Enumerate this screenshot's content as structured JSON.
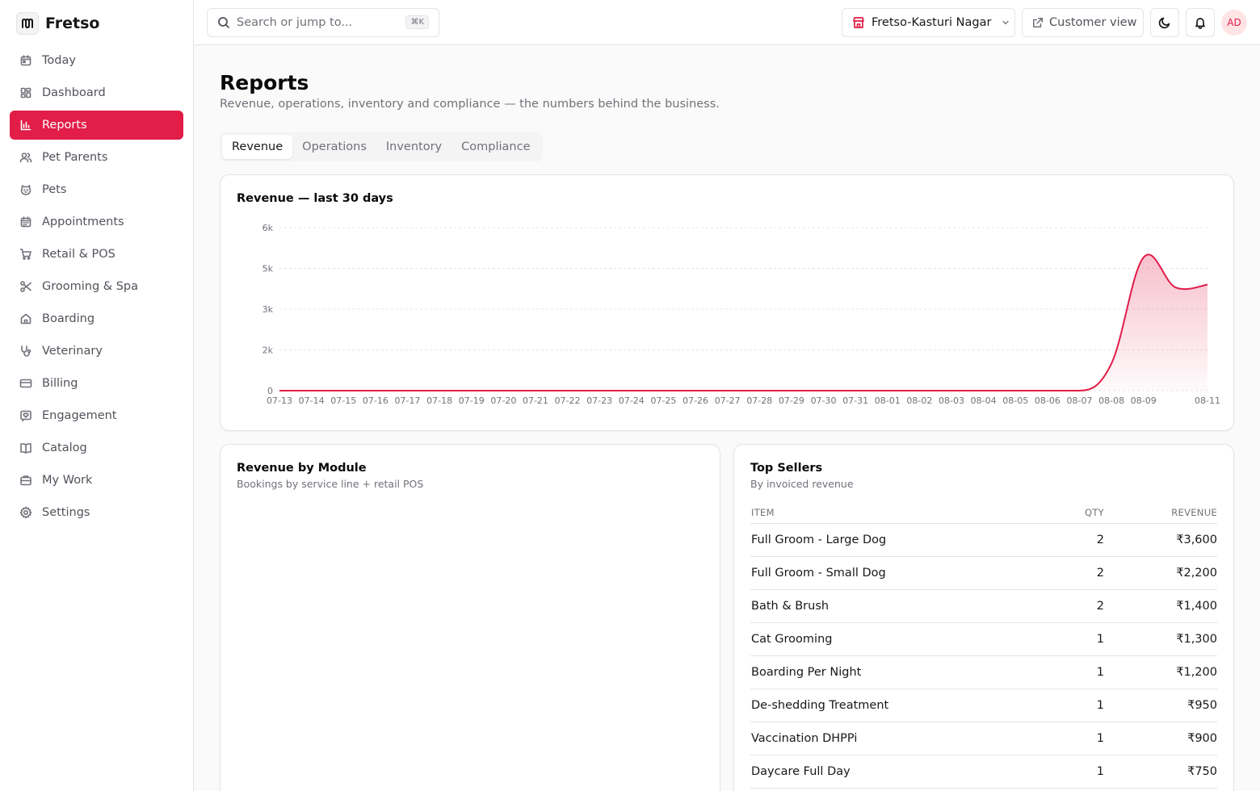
{
  "brand": {
    "name": "Fretso"
  },
  "sidebar": {
    "items": [
      {
        "label": "Today",
        "icon": "calendar-icon",
        "active": false
      },
      {
        "label": "Dashboard",
        "icon": "layout-grid-icon",
        "active": false
      },
      {
        "label": "Reports",
        "icon": "bar-chart-icon",
        "active": true
      },
      {
        "label": "Pet Parents",
        "icon": "users-icon",
        "active": false
      },
      {
        "label": "Pets",
        "icon": "paw-icon",
        "active": false
      },
      {
        "label": "Appointments",
        "icon": "calendar-days-icon",
        "active": false
      },
      {
        "label": "Retail & POS",
        "icon": "shopping-cart-icon",
        "active": false
      },
      {
        "label": "Grooming & Spa",
        "icon": "scissors-icon",
        "active": false
      },
      {
        "label": "Boarding",
        "icon": "home-icon",
        "active": false
      },
      {
        "label": "Veterinary",
        "icon": "stethoscope-icon",
        "active": false
      },
      {
        "label": "Billing",
        "icon": "credit-card-icon",
        "active": false
      },
      {
        "label": "Engagement",
        "icon": "message-heart-icon",
        "active": false
      },
      {
        "label": "Catalog",
        "icon": "book-open-icon",
        "active": false
      },
      {
        "label": "My Work",
        "icon": "briefcase-icon",
        "active": false
      },
      {
        "label": "Settings",
        "icon": "gear-icon",
        "active": false
      }
    ]
  },
  "topbar": {
    "search_placeholder": "Search or jump to...",
    "search_shortcut": "⌘K",
    "location": "Fretso-Kasturi Nagar",
    "customer_view": "Customer view",
    "avatar_initials": "AD"
  },
  "page": {
    "title": "Reports",
    "subtitle": "Revenue, operations, inventory and compliance — the numbers behind the business."
  },
  "tabs": [
    {
      "label": "Revenue",
      "active": true
    },
    {
      "label": "Operations",
      "active": false
    },
    {
      "label": "Inventory",
      "active": false
    },
    {
      "label": "Compliance",
      "active": false
    }
  ],
  "revenue_chart": {
    "title": "Revenue — last 30 days"
  },
  "chart_data": {
    "type": "area",
    "title": "Revenue — last 30 days",
    "xlabel": "",
    "ylabel": "",
    "x": [
      "07-13",
      "07-14",
      "07-15",
      "07-16",
      "07-17",
      "07-18",
      "07-19",
      "07-20",
      "07-21",
      "07-22",
      "07-23",
      "07-24",
      "07-25",
      "07-26",
      "07-27",
      "07-28",
      "07-29",
      "07-30",
      "07-31",
      "08-01",
      "08-02",
      "08-03",
      "08-04",
      "08-05",
      "08-06",
      "08-07",
      "08-08",
      "08-09",
      "08-10",
      "08-11"
    ],
    "x_tick_labels": [
      "07-13",
      "07-14",
      "07-15",
      "07-16",
      "07-17",
      "07-18",
      "07-19",
      "07-20",
      "07-21",
      "07-22",
      "07-23",
      "07-24",
      "07-25",
      "07-26",
      "07-27",
      "07-28",
      "07-29",
      "07-30",
      "07-31",
      "08-01",
      "08-02",
      "08-03",
      "08-04",
      "08-05",
      "08-06",
      "08-07",
      "08-08",
      "08-09",
      "",
      "08-11"
    ],
    "values": [
      0,
      0,
      0,
      0,
      0,
      0,
      0,
      0,
      0,
      0,
      0,
      0,
      0,
      0,
      0,
      0,
      0,
      0,
      0,
      0,
      0,
      0,
      0,
      0,
      0,
      0,
      1000,
      4900,
      3800,
      3900
    ],
    "yticks": [
      0,
      1500,
      3000,
      4500,
      6000
    ],
    "ytick_labels": [
      "0",
      "2k",
      "3k",
      "5k",
      "6k"
    ],
    "ylim": [
      0,
      6000
    ],
    "grid": true,
    "color": "#e11d48"
  },
  "module_card": {
    "title": "Revenue by Module",
    "subtitle": "Bookings by service line + retail POS"
  },
  "sellers_card": {
    "title": "Top Sellers",
    "subtitle": "By invoiced revenue",
    "columns": [
      "ITEM",
      "QTY",
      "REVENUE"
    ],
    "rows": [
      {
        "item": "Full Groom - Large Dog",
        "qty": "2",
        "revenue": "₹3,600"
      },
      {
        "item": "Full Groom - Small Dog",
        "qty": "2",
        "revenue": "₹2,200"
      },
      {
        "item": "Bath & Brush",
        "qty": "2",
        "revenue": "₹1,400"
      },
      {
        "item": "Cat Grooming",
        "qty": "1",
        "revenue": "₹1,300"
      },
      {
        "item": "Boarding Per Night",
        "qty": "1",
        "revenue": "₹1,200"
      },
      {
        "item": "De-shedding Treatment",
        "qty": "1",
        "revenue": "₹950"
      },
      {
        "item": "Vaccination DHPPi",
        "qty": "1",
        "revenue": "₹900"
      },
      {
        "item": "Daycare Full Day",
        "qty": "1",
        "revenue": "₹750"
      }
    ]
  },
  "colors": {
    "accent": "#e11d48",
    "border": "#e4e4e7",
    "muted": "#71717a"
  }
}
